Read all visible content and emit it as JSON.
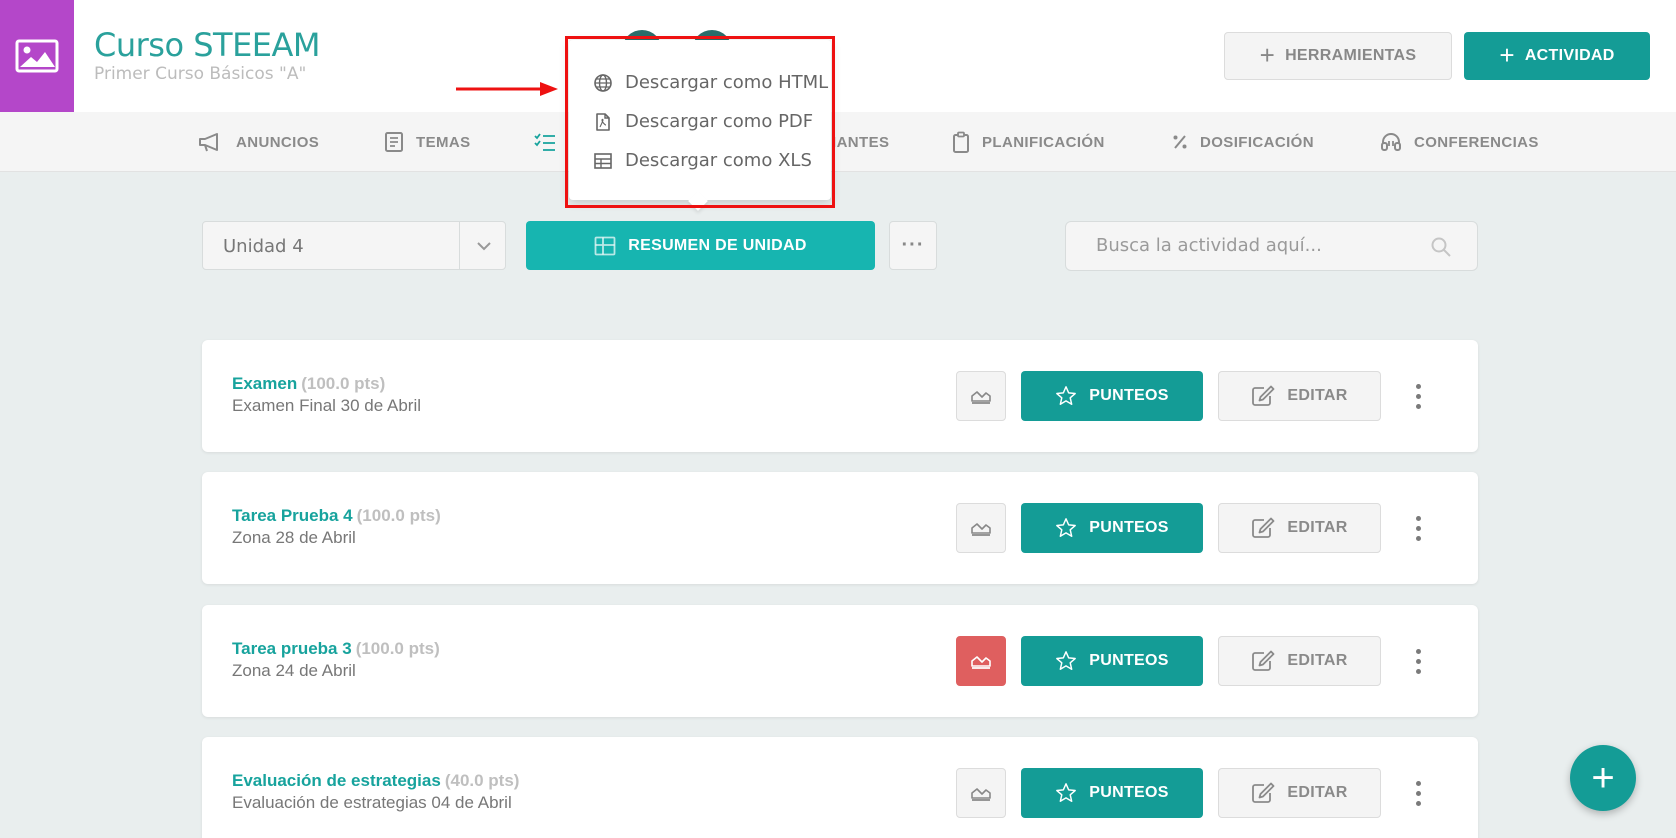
{
  "header": {
    "course_title": "Curso STEEAM",
    "course_subtitle": "Primer Curso Básicos \"A\"",
    "tools_button": "HERRAMIENTAS",
    "activity_button": "ACTIVIDAD"
  },
  "nav": {
    "items": [
      {
        "label": "ANUNCIOS",
        "icon": "megaphone-icon"
      },
      {
        "label": "TEMAS",
        "icon": "book-icon"
      },
      {
        "label": "",
        "icon": "checklist-icon"
      },
      {
        "label": "IANTES",
        "icon": ""
      },
      {
        "label": "PLANIFICACIÓN",
        "icon": "clipboard-icon"
      },
      {
        "label": "DOSIFICACIÓN",
        "icon": "percent-icon"
      },
      {
        "label": "CONFERENCIAS",
        "icon": "headset-icon"
      }
    ]
  },
  "toolbar": {
    "unit_value": "Unidad 4",
    "summary_button": "RESUMEN DE UNIDAD",
    "more_button": "···",
    "search_placeholder": "Busca la actividad aquí..."
  },
  "download_menu": {
    "items": [
      {
        "label": "Descargar como HTML",
        "icon": "globe-icon"
      },
      {
        "label": "Descargar como PDF",
        "icon": "pdf-file-icon"
      },
      {
        "label": "Descargar como XLS",
        "icon": "table-icon"
      }
    ]
  },
  "activities": [
    {
      "title": "Examen",
      "points": "(100.0 pts)",
      "description": "Examen Final 30 de Abril",
      "chart_alert": false
    },
    {
      "title": "Tarea Prueba 4",
      "points": "(100.0 pts)",
      "description": "Zona 28 de Abril",
      "chart_alert": false
    },
    {
      "title": "Tarea prueba 3",
      "points": "(100.0 pts)",
      "description": "Zona 24 de Abril",
      "chart_alert": true
    },
    {
      "title": "Evaluación de estrategias",
      "points": "(40.0 pts)",
      "description": "Evaluación de estrategias 04 de Abril",
      "chart_alert": false
    }
  ],
  "card_actions": {
    "grades_button": "PUNTEOS",
    "edit_button": "EDITAR"
  },
  "fab_label": "+",
  "colors": {
    "accent": "#149c96",
    "accent_light": "#17b5b0",
    "course_thumb": "#b447c9",
    "alert": "#df5f5f",
    "annotation_red": "#ee1111"
  }
}
